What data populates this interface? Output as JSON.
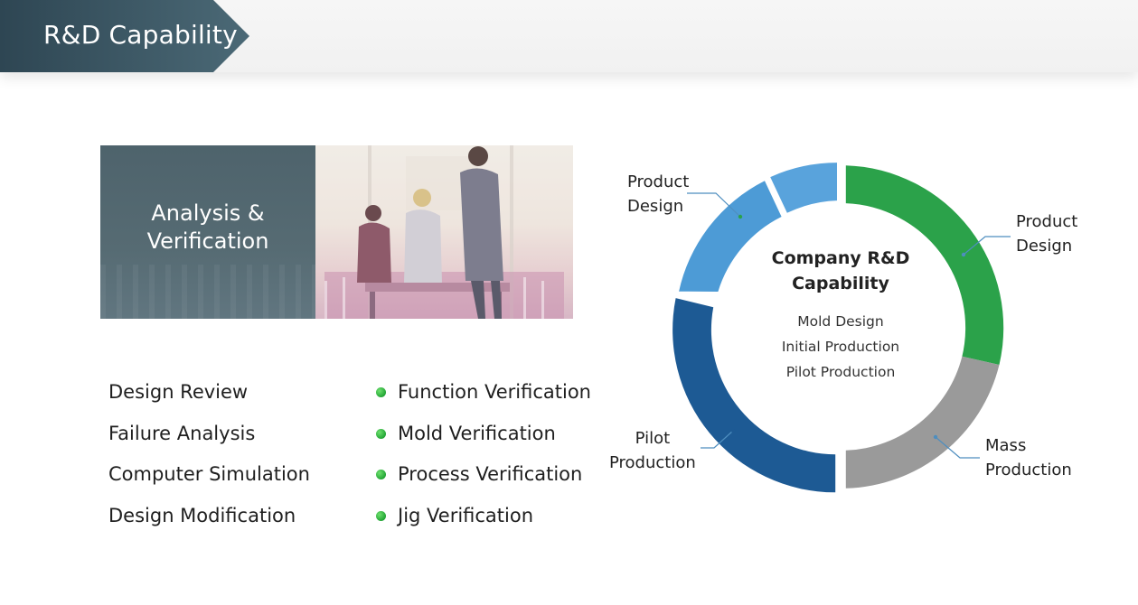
{
  "header": {
    "title": "R&D Capability"
  },
  "banner": {
    "title_line1": "Analysis &",
    "title_line2": "Verification"
  },
  "analysis_list": [
    "Design Review",
    "Failure Analysis",
    "Computer Simulation",
    "Design Modification"
  ],
  "verification_list": [
    "Function Verification",
    "Mold Verification",
    "Process Verification",
    "Jig Verification"
  ],
  "diagram": {
    "center_title_line1": "Company R&D",
    "center_title_line2": "Capability",
    "center_items": [
      "Mold Design",
      "Initial Production",
      "Pilot Production"
    ],
    "segments": [
      {
        "label_line1": "Product",
        "label_line2": "Design",
        "color": "#2ba24a"
      },
      {
        "label_line1": "Mass",
        "label_line2": "Production",
        "color": "#9a9a9a"
      },
      {
        "label_line1": "Pilot",
        "label_line2": "Production",
        "color": "#1d5a94"
      },
      {
        "label_line1": "Product",
        "label_line2": "Design",
        "color": "#4d9bd6"
      },
      {
        "label_line1": "",
        "label_line2": "",
        "color": "#59a3dc"
      }
    ]
  },
  "colors": {
    "header_arrow": "#2e4653",
    "bullet": "#2ba33c",
    "leader_line": "#4e8ebf"
  }
}
